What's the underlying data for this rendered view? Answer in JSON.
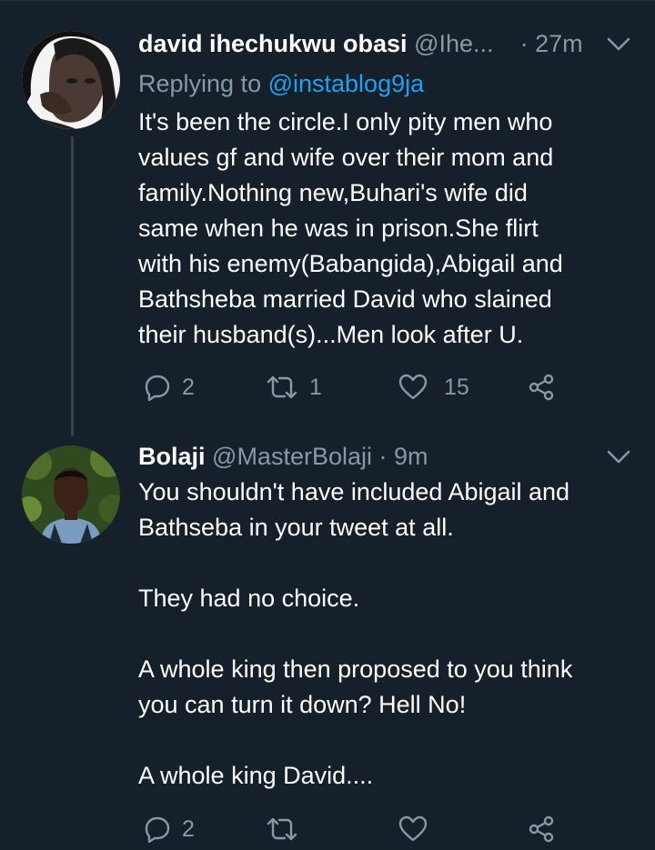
{
  "tweets": [
    {
      "name": "david ihechukwu obasi",
      "handle": "@Ihe...",
      "time": "· 27m",
      "replying_prefix": "Replying to ",
      "replying_to": "@instablog9ja",
      "text_lines": [
        "It's been the circle.I only pity men who",
        "values gf and wife over their mom and",
        "family.Nothing new,Buhari's wife did",
        "same when he was in prison.She flirt",
        "with his enemy(Babangida),Abigail and",
        "Bathsheba married David who slained",
        "their husband(s)...Men look after U."
      ],
      "replies": "2",
      "retweets": "1",
      "likes": "15"
    },
    {
      "name": "Bolaji",
      "handle": "@MasterBolaji",
      "time": "· 9m",
      "text_lines": [
        "You shouldn't have included Abigail and",
        "Bathseba in your tweet at all.",
        "",
        "They had no choice.",
        "",
        "A whole king then proposed to you think",
        "you can turn it down? Hell No!",
        "",
        "A whole king David...."
      ],
      "replies": "2",
      "retweets": "",
      "likes": ""
    }
  ],
  "icons": {
    "reply": "reply-icon",
    "retweet": "retweet-icon",
    "like": "heart-icon",
    "share": "share-icon",
    "menu": "chevron-down-icon"
  },
  "colors": {
    "background": "#15202b",
    "text": "#ffffff",
    "secondary": "#8899a6",
    "link": "#1da1f2",
    "thread_line": "#38444d"
  }
}
